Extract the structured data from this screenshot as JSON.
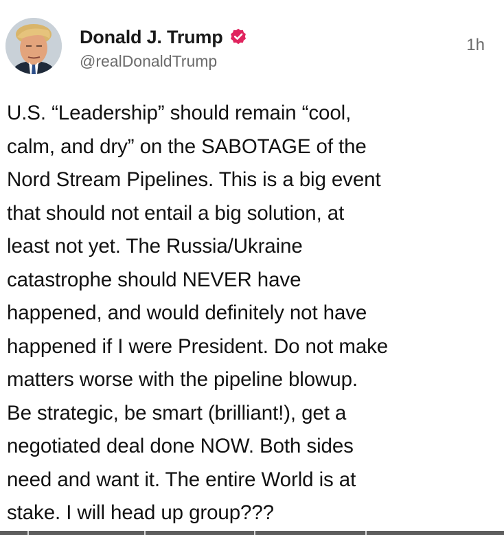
{
  "post": {
    "author": {
      "display_name": "Donald J. Trump",
      "handle": "@realDonaldTrump",
      "verified": true,
      "verified_color": "#e0245e",
      "avatar_icon": "avatar-photo"
    },
    "timestamp": "1h",
    "body_lines": [
      "U.S. “Leadership” should remain “cool,",
      "calm, and dry” on the SABOTAGE of the",
      "Nord Stream Pipelines. This is a big event",
      "that should not entail a big solution, at",
      "least not yet. The Russia/Ukraine",
      "catastrophe should NEVER have",
      "happened, and would definitely not have",
      "happened if I were President. Do not make",
      "matters worse with the pipeline blowup.",
      "Be strategic, be smart (brilliant!), get a",
      "negotiated deal done NOW. Both sides",
      "need and want it. The entire World is at",
      "stake. I will head up group???"
    ]
  },
  "colors": {
    "text": "#121212",
    "secondary_text": "#6b6b6b",
    "background": "#ffffff"
  }
}
